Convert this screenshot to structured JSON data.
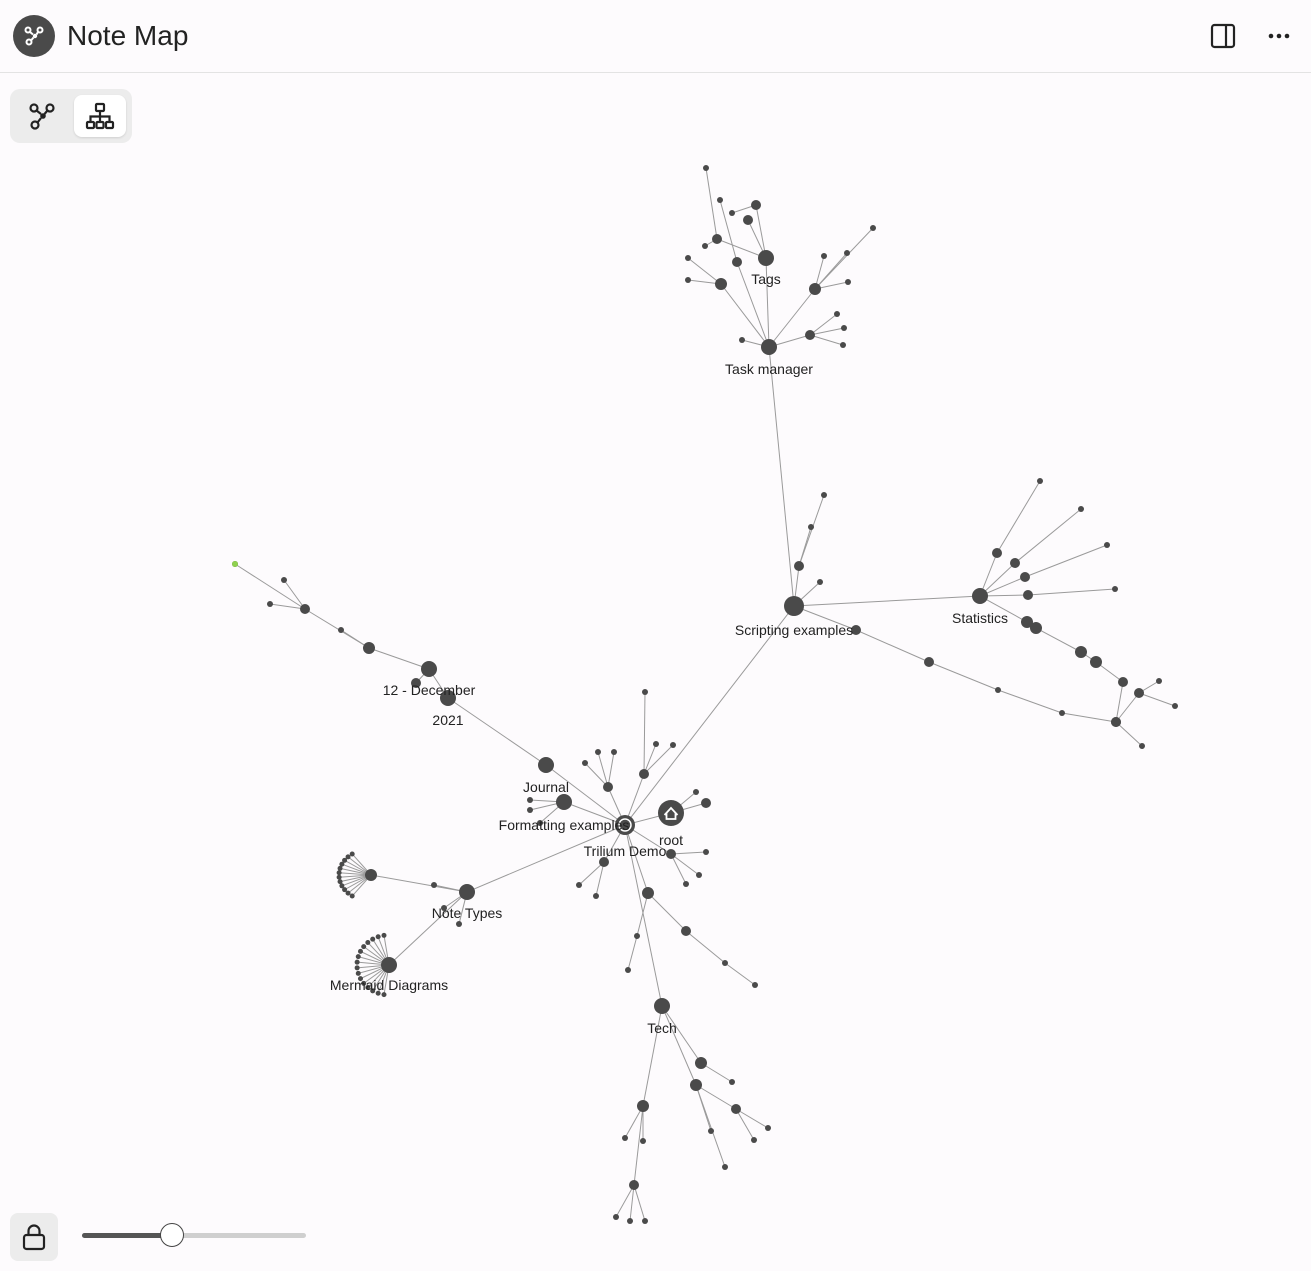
{
  "header": {
    "title": "Note Map",
    "app_icon": "note-map-icon",
    "sidebar_toggle_icon": "sidebar-toggle-icon",
    "more_icon": "more-horizontal-icon"
  },
  "toolbar": {
    "modes": [
      {
        "name": "link-map",
        "icon": "graph-icon",
        "active": false
      },
      {
        "name": "tree-map",
        "icon": "hierarchy-icon",
        "active": true
      }
    ]
  },
  "graph": {
    "labels": {
      "tags": "Tags",
      "task_manager": "Task manager",
      "scripting": "Scripting examples",
      "statistics": "Statistics",
      "december": "12 - December",
      "year": "2021",
      "journal": "Journal",
      "formatting": "Formatting examples",
      "trilium": "Trilium Demo",
      "root": "root",
      "note_types": "Note Types",
      "mermaid": "Mermaid Diagrams",
      "tech": "Tech"
    },
    "colors": {
      "node": "#4a4a4a",
      "edge": "#9a9a9a",
      "highlight": "#8fd14f"
    }
  },
  "footer": {
    "lock_icon": "lock-icon",
    "zoom_level": 0.4
  }
}
